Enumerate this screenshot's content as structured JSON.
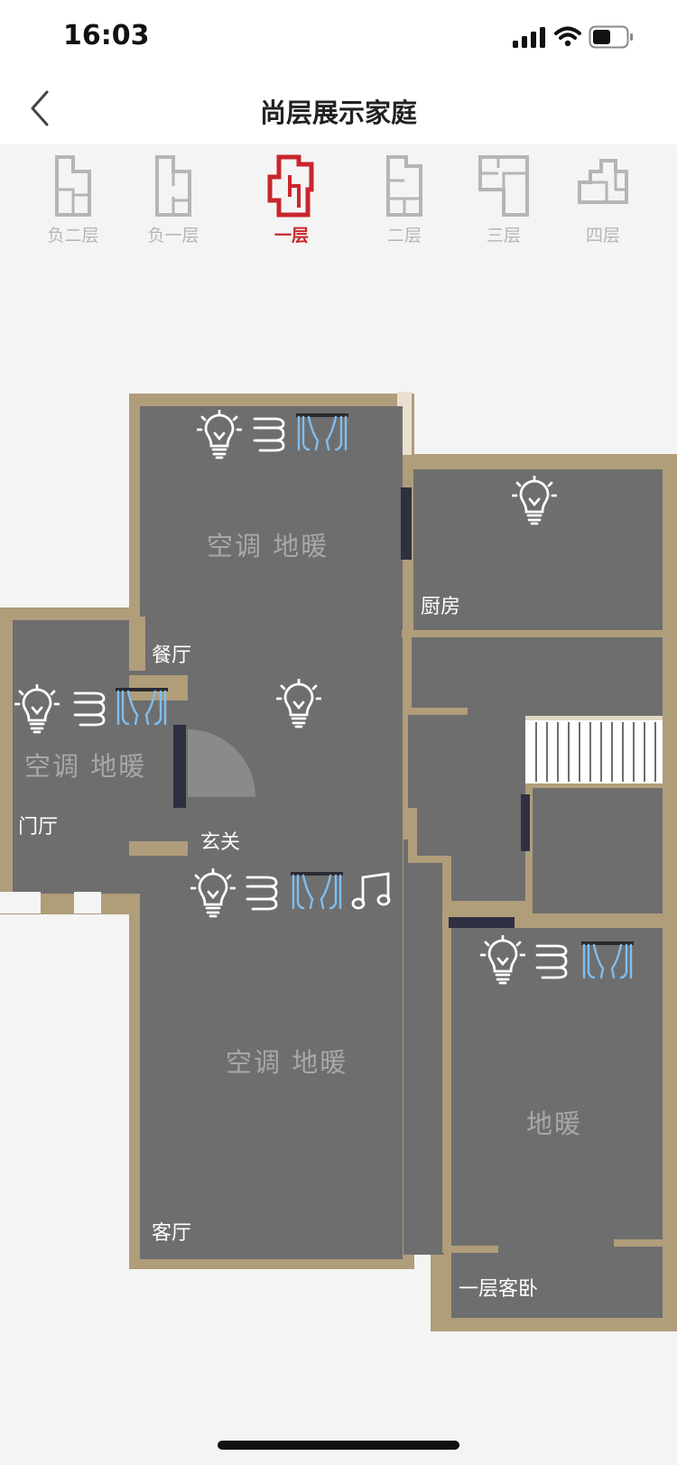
{
  "status": {
    "time": "16:03"
  },
  "header": {
    "title": "尚层展示家庭"
  },
  "tabs": [
    {
      "label": "负二层"
    },
    {
      "label": "负一层"
    },
    {
      "label": "一层",
      "active": true
    },
    {
      "label": "二层"
    },
    {
      "label": "三层"
    },
    {
      "label": "四层"
    }
  ],
  "rooms": {
    "dining": {
      "name": "餐厅",
      "devices": "空调  地暖"
    },
    "kitchen": {
      "name": "厨房"
    },
    "foyer": {
      "name": "门厅",
      "devices": "空调  地暖"
    },
    "entrance": {
      "name": "玄关"
    },
    "living": {
      "name": "客厅",
      "devices": "空调  地暖"
    },
    "bedroom": {
      "name": "一层客卧",
      "devices": "地暖"
    }
  },
  "colors": {
    "accent": "#c8262c",
    "wall": "#b09d7a",
    "floor": "#6e6e6e",
    "curtain": "#7fbef0"
  }
}
